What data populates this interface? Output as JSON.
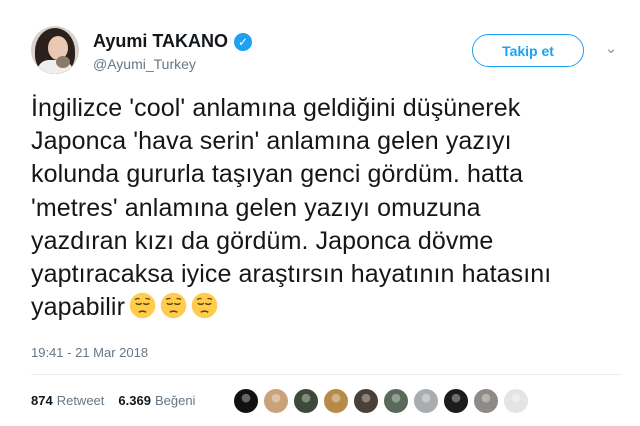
{
  "user": {
    "name": "Ayumi TAKANO",
    "handle": "@Ayumi_Turkey",
    "verified_icon": "verified-badge-icon",
    "avatar_icon": "profile-photo"
  },
  "actions": {
    "follow_label": "Takip et",
    "caret_icon": "chevron-down-icon"
  },
  "tweet": {
    "lines": [
      "İngilizce 'cool' anlamına geldiğini düşünerek",
      "Japonca 'hava serin' anlamına gelen yazıyı",
      "kolunda gururla taşıyan genci gördüm. hatta",
      "'metres' anlamına gelen yazıyı omuzuna",
      "yazdıran kızı da gördüm. Japonca dövme",
      "yaptıracaksa iyice araştırsın hayatının hatasını",
      "yapabilir"
    ],
    "emoji": [
      "pensive-face-emoji",
      "pensive-face-emoji",
      "pensive-face-emoji"
    ],
    "timestamp": "19:41 - 21 Mar 2018"
  },
  "stats": {
    "retweet_count": "874",
    "retweet_label": "Retweet",
    "like_count": "6.369",
    "like_label": "Beğeni"
  },
  "likers": [
    {
      "icon": "liker-avatar-1",
      "color": "#111111"
    },
    {
      "icon": "liker-avatar-2",
      "color": "#c9a27a"
    },
    {
      "icon": "liker-avatar-3",
      "color": "#3d4a3a"
    },
    {
      "icon": "liker-avatar-4",
      "color": "#b88a4a"
    },
    {
      "icon": "liker-avatar-5",
      "color": "#4a4038"
    },
    {
      "icon": "liker-avatar-6",
      "color": "#5a6a5a"
    },
    {
      "icon": "liker-avatar-7",
      "color": "#a9adb0"
    },
    {
      "icon": "liker-avatar-8",
      "color": "#1c1c1c"
    },
    {
      "icon": "liker-avatar-9",
      "color": "#8e8a86"
    },
    {
      "icon": "liker-avatar-10",
      "color": "#e4e4e4"
    }
  ],
  "colors": {
    "accent": "#1da1f2",
    "text": "#14171a",
    "muted": "#657786"
  }
}
